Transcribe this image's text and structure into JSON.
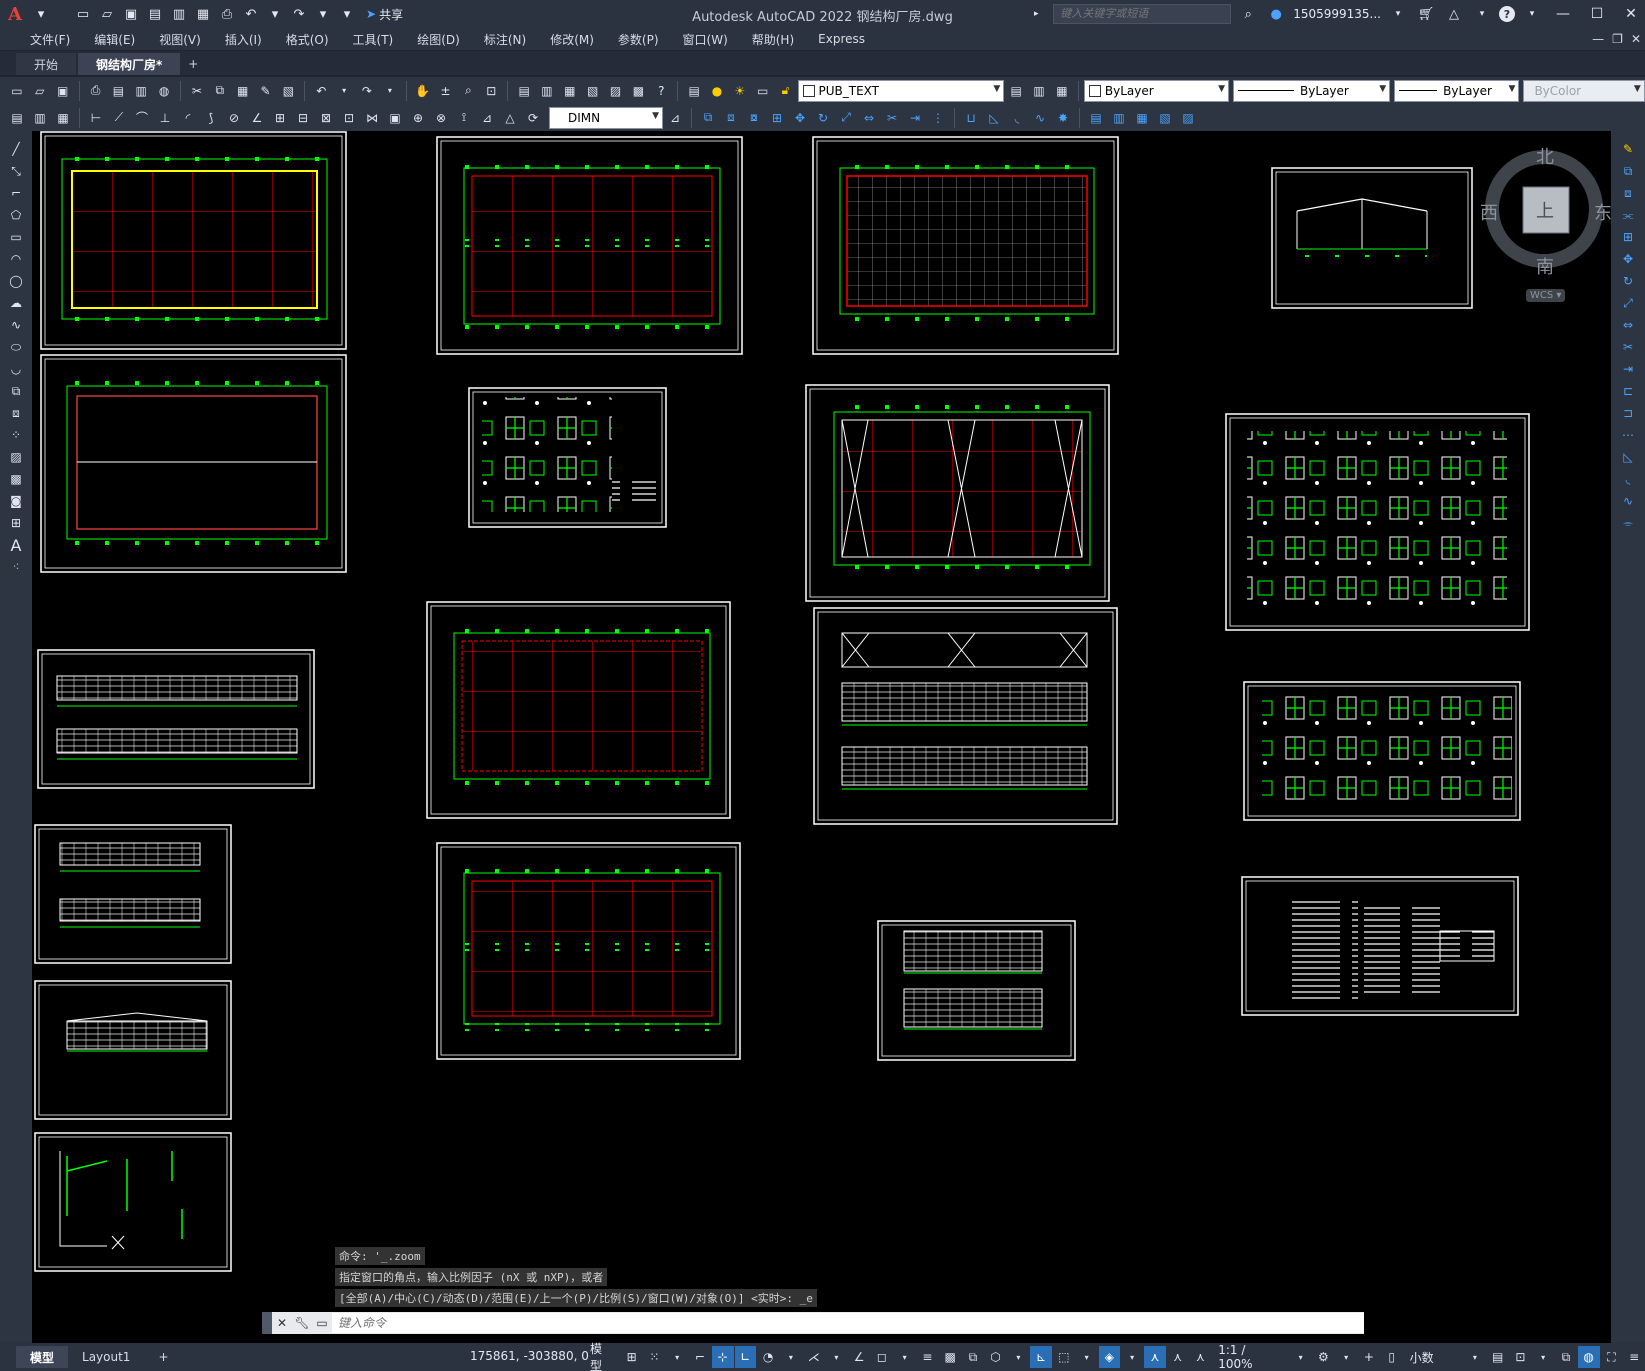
{
  "titlebar": {
    "app_logo": "A",
    "share_label": "共享",
    "title": "Autodesk AutoCAD 2022    钢结构厂房.dwg",
    "search_placeholder": "键入关键字或短语",
    "user": "1505999135...",
    "help": "?"
  },
  "menu": {
    "items": [
      "文件(F)",
      "编辑(E)",
      "视图(V)",
      "插入(I)",
      "格式(O)",
      "工具(T)",
      "绘图(D)",
      "标注(N)",
      "修改(M)",
      "参数(P)",
      "窗口(W)",
      "帮助(H)",
      "Express"
    ]
  },
  "tabs": {
    "items": [
      {
        "label": "开始",
        "active": false
      },
      {
        "label": "钢结构厂房*",
        "active": true
      }
    ],
    "add": "+"
  },
  "toolbar1": {
    "layer_value": "PUB_TEXT",
    "color_value": "ByLayer",
    "linetype_value": "ByLayer",
    "lineweight_value": "ByLayer",
    "plotstyle_value": "ByColor"
  },
  "toolbar2": {
    "dimstyle_value": "DIMN"
  },
  "viewcube": {
    "north": "北",
    "south": "南",
    "east": "东",
    "west": "西",
    "face": "上",
    "wcs": "WCS"
  },
  "command": {
    "history": [
      "命令: '_.zoom",
      "指定窗口的角点，输入比例因子 (nX 或 nXP)，或者",
      "[全部(A)/中心(C)/动态(D)/范围(E)/上一个(P)/比例(S)/窗口(W)/对象(O)] <实时>: _e"
    ],
    "placeholder": "键入命令"
  },
  "statusbar": {
    "layouts": [
      {
        "label": "模型",
        "active": true
      },
      {
        "label": "Layout1",
        "active": false
      }
    ],
    "add": "+",
    "coords": "175861, -303880, 0",
    "space": "模型",
    "scale": "1:1 / 100%",
    "units": "小数"
  },
  "colors": {
    "frame": "#ffffff",
    "green": "#00ff00",
    "red": "#ff0000",
    "yellow": "#ffff00"
  }
}
